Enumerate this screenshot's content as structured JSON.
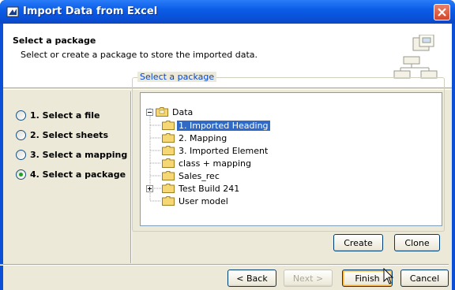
{
  "window": {
    "title": "Import Data from Excel"
  },
  "header": {
    "title": "Select a package",
    "subtitle": "Select or create a package to store the imported data."
  },
  "steps": [
    {
      "label": "1. Select a file",
      "selected": false
    },
    {
      "label": "2. Select sheets",
      "selected": false
    },
    {
      "label": "3. Select a mapping",
      "selected": false
    },
    {
      "label": "4. Select a package",
      "selected": true
    }
  ],
  "package_group": {
    "legend": "Select a package"
  },
  "tree": {
    "root": "Data",
    "items": [
      {
        "label": "1. Imported Heading",
        "selected": true,
        "expandable": false
      },
      {
        "label": "2. Mapping",
        "selected": false,
        "expandable": false
      },
      {
        "label": "3. Imported Element",
        "selected": false,
        "expandable": false
      },
      {
        "label": "class + mapping",
        "selected": false,
        "expandable": false
      },
      {
        "label": "Sales_rec",
        "selected": false,
        "expandable": false
      },
      {
        "label": "Test Build 241",
        "selected": false,
        "expandable": true
      },
      {
        "label": "User model",
        "selected": false,
        "expandable": false
      }
    ]
  },
  "buttons": {
    "create": "Create",
    "clone": "Clone",
    "back": "< Back",
    "next": "Next >",
    "finish": "Finish",
    "cancel": "Cancel"
  },
  "icons": {
    "title": "import-window-icon",
    "close": "close-icon",
    "header": "package-hierarchy-icon",
    "folder": "folder-icon",
    "cursor": "mouse-pointer-icon"
  },
  "colors": {
    "titlebar": "#0a4fd6",
    "selection": "#316ac5",
    "legend_text": "#0046d5",
    "dialog_bg": "#ece9d8",
    "radio_selected": "#21a121"
  }
}
